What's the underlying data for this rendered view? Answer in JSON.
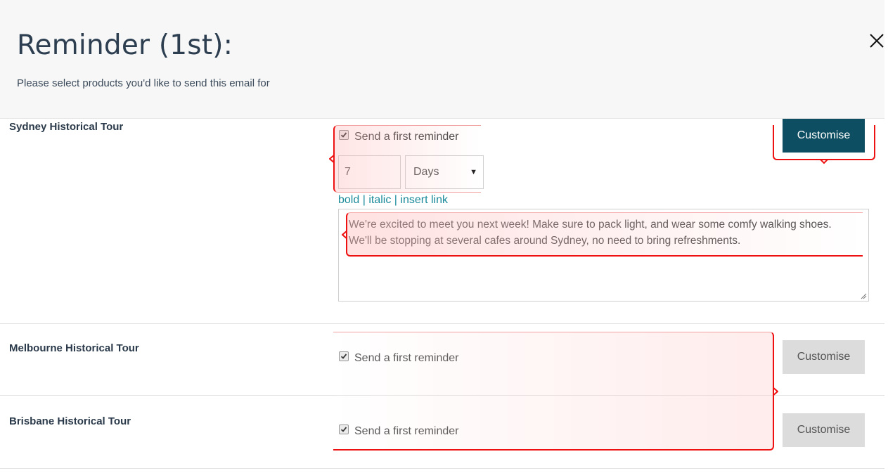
{
  "header": {
    "title": "Reminder (1st):",
    "subtitle": "Please select products you'd like to send this email for"
  },
  "products": [
    {
      "name": "Sydney Historical Tour",
      "checkbox_label": "Send a first reminder",
      "checked": true,
      "delay_value": "7",
      "delay_unit": "Days",
      "format_links": [
        "bold",
        "italic",
        "insert link"
      ],
      "message_lines": [
        "We're excited to meet you next week! Make sure to pack light, and wear some comfy walking shoes.",
        "We'll be stopping at several cafes around Sydney, no need to bring refreshments."
      ],
      "button_label": "Customise",
      "button_state": "active"
    },
    {
      "name": "Melbourne Historical Tour",
      "checkbox_label": "Send a first reminder",
      "checked": true,
      "button_label": "Customise",
      "button_state": "inactive"
    },
    {
      "name": "Brisbane Historical Tour",
      "checkbox_label": "Send a first reminder",
      "checked": true,
      "button_label": "Customise",
      "button_state": "inactive"
    }
  ],
  "colors": {
    "primary_button": "#0e4e62",
    "secondary_button": "#dcdcdc",
    "link": "#1a8a9a",
    "annotation": "#e11111"
  },
  "icons": {
    "close": "close-icon",
    "checkbox": "checkmark-icon",
    "select_arrow": "caret-down-icon"
  }
}
